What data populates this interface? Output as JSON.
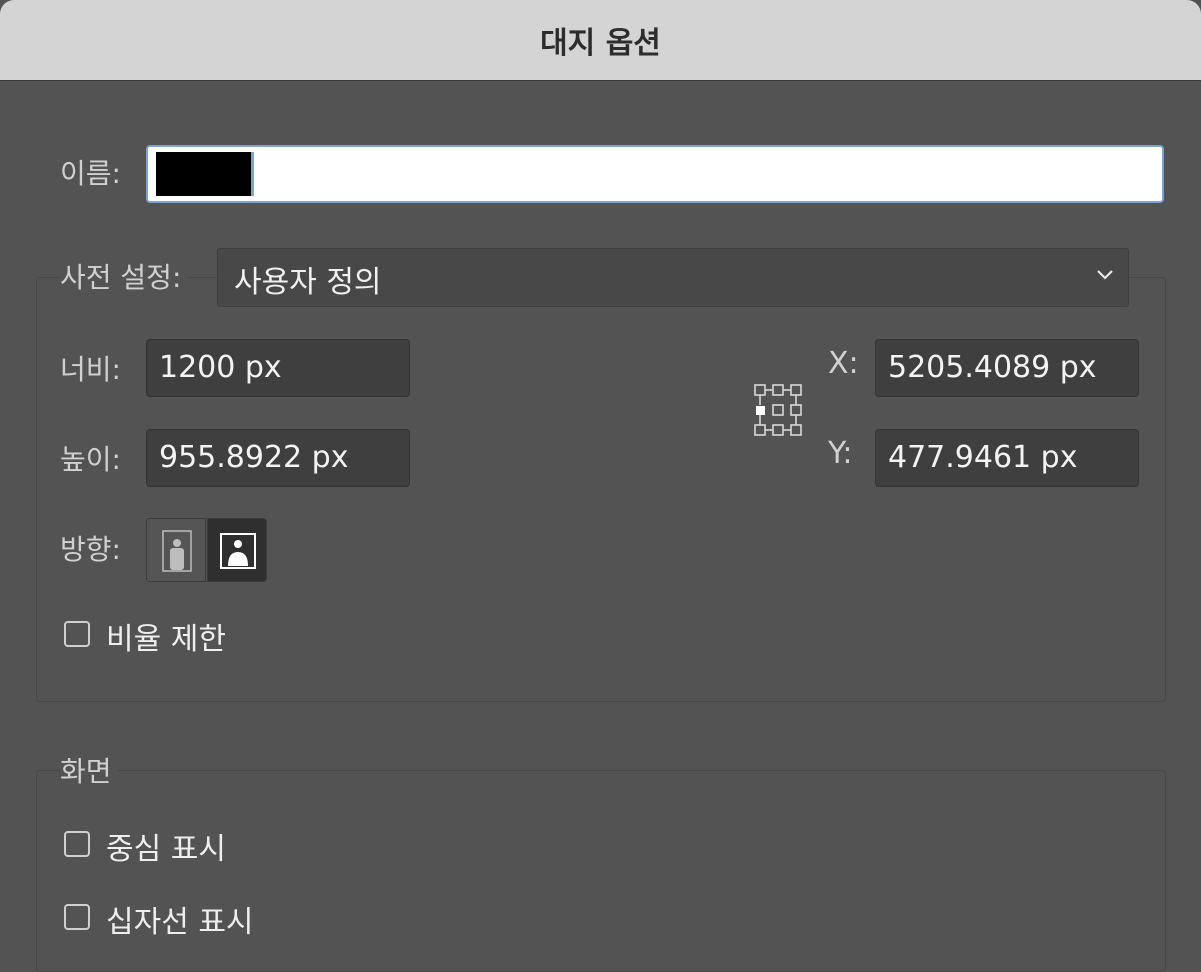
{
  "dialog": {
    "title": "대지 옵션"
  },
  "name": {
    "label": "이름:",
    "value": ""
  },
  "preset": {
    "label": "사전 설정:",
    "selected": "사용자 정의",
    "icon": "chevron-down-icon"
  },
  "size": {
    "width_label": "너비:",
    "width_value": "1200 px",
    "height_label": "높이:",
    "height_value": "955.8922 px"
  },
  "position": {
    "x_label": "X:",
    "x_value": "5205.4089 px",
    "y_label": "Y:",
    "y_value": "477.9461 px",
    "reference_icon": "reference-point-icon"
  },
  "orientation": {
    "label": "방향:",
    "options": [
      "portrait-icon",
      "landscape-icon"
    ],
    "selected": "landscape"
  },
  "constrain": {
    "label": "비율 제한",
    "checked": false
  },
  "display": {
    "section_label": "화면",
    "show_center": {
      "label": "중심 표시",
      "checked": false
    },
    "show_crosshairs": {
      "label": "십자선 표시",
      "checked": false
    }
  },
  "colors": {
    "background": "#535353",
    "accent": "#7aa3d6",
    "titlebar": "#d4d4d4"
  }
}
